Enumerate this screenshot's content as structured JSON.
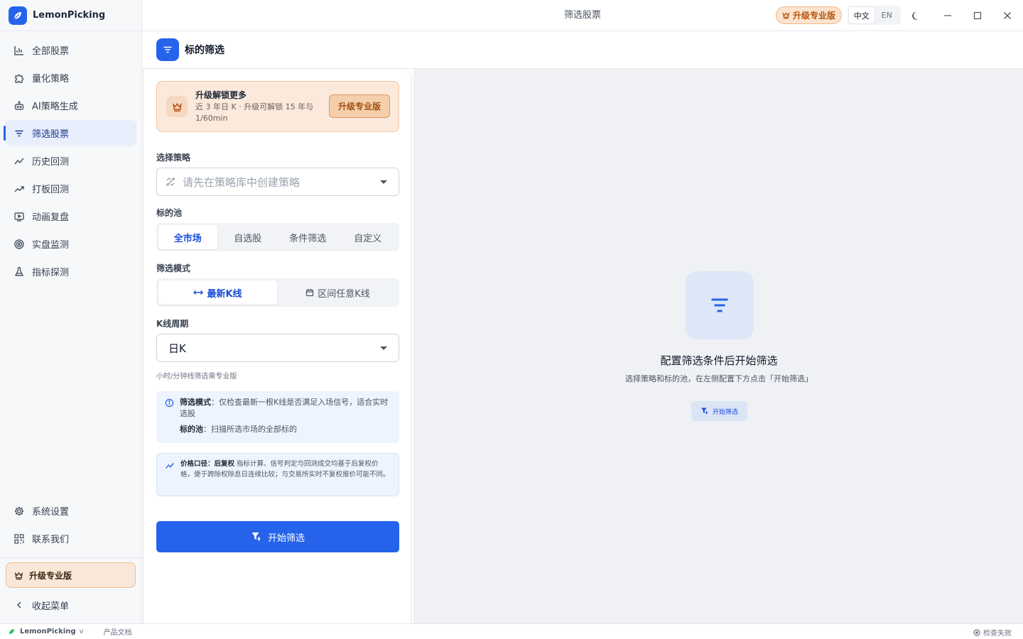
{
  "app": {
    "name": "LemonPicking",
    "window_title": "筛选股票"
  },
  "sidebar": {
    "items": [
      {
        "label": "全部股票",
        "icon": "bar-chart-icon"
      },
      {
        "label": "量化策略",
        "icon": "puzzle-icon"
      },
      {
        "label": "AI策略生成",
        "icon": "robot-icon"
      },
      {
        "label": "筛选股票",
        "icon": "filter-icon",
        "active": true
      },
      {
        "label": "历史回测",
        "icon": "trend-icon"
      },
      {
        "label": "打板回测",
        "icon": "trend-up-icon"
      },
      {
        "label": "动画复盘",
        "icon": "play-screen-icon"
      },
      {
        "label": "实盘监测",
        "icon": "radar-icon"
      },
      {
        "label": "指标探测",
        "icon": "flask-icon"
      }
    ],
    "bottom_items": [
      {
        "label": "系统设置",
        "icon": "gear-icon"
      },
      {
        "label": "联系我们",
        "icon": "qr-code-icon"
      }
    ],
    "upgrade_label": "升级专业版",
    "collapse_label": "收起菜单"
  },
  "topbar": {
    "upgrade_label": "升级专业版",
    "lang": {
      "zh": "中文",
      "en": "EN",
      "selected": "zh"
    }
  },
  "page": {
    "title": "标的筛选"
  },
  "promo": {
    "title": "升级解锁更多",
    "desc": "近 3 年日 K · 升级可解锁 15 年与 1/60min",
    "button": "升级专业版"
  },
  "form": {
    "strategy_label": "选择策略",
    "strategy_placeholder": "请先在策略库中创建策略",
    "pool_label": "标的池",
    "pool_options": [
      "全市场",
      "自选股",
      "条件筛选",
      "自定义"
    ],
    "pool_selected": "全市场",
    "mode_label": "筛选模式",
    "mode_options": [
      "最新K线",
      "区间任意K线"
    ],
    "mode_selected": "最新K线",
    "period_label": "K线周期",
    "period_value": "日K",
    "period_hint": "小时/分钟线筛选需专业版",
    "info": {
      "mode_key": "筛选模式",
      "mode_text": "仅检查最新一根K线是否满足入场信号，适合实时选股",
      "pool_key": "标的池",
      "pool_text": "扫描所选市场的全部标的"
    },
    "price": {
      "key": "价格口径：后复权",
      "text": "指标计算、信号判定与回测成交均基于后复权价格，便于跨除权除息日连续比较；与交易所实时不复权报价可能不同。"
    },
    "start_button": "开始筛选"
  },
  "empty_state": {
    "title": "配置筛选条件后开始筛选",
    "desc": "选择策略和标的池，在左侧配置下方点击「开始筛选」",
    "button": "开始筛选"
  },
  "footer": {
    "app_name": "LemonPicking",
    "version": "v",
    "doc_link": "产品文档",
    "status": "检查失败"
  },
  "colors": {
    "accent": "#2563eb",
    "upgrade_bg": "#fbe3cf",
    "upgrade_text": "#b45309"
  }
}
